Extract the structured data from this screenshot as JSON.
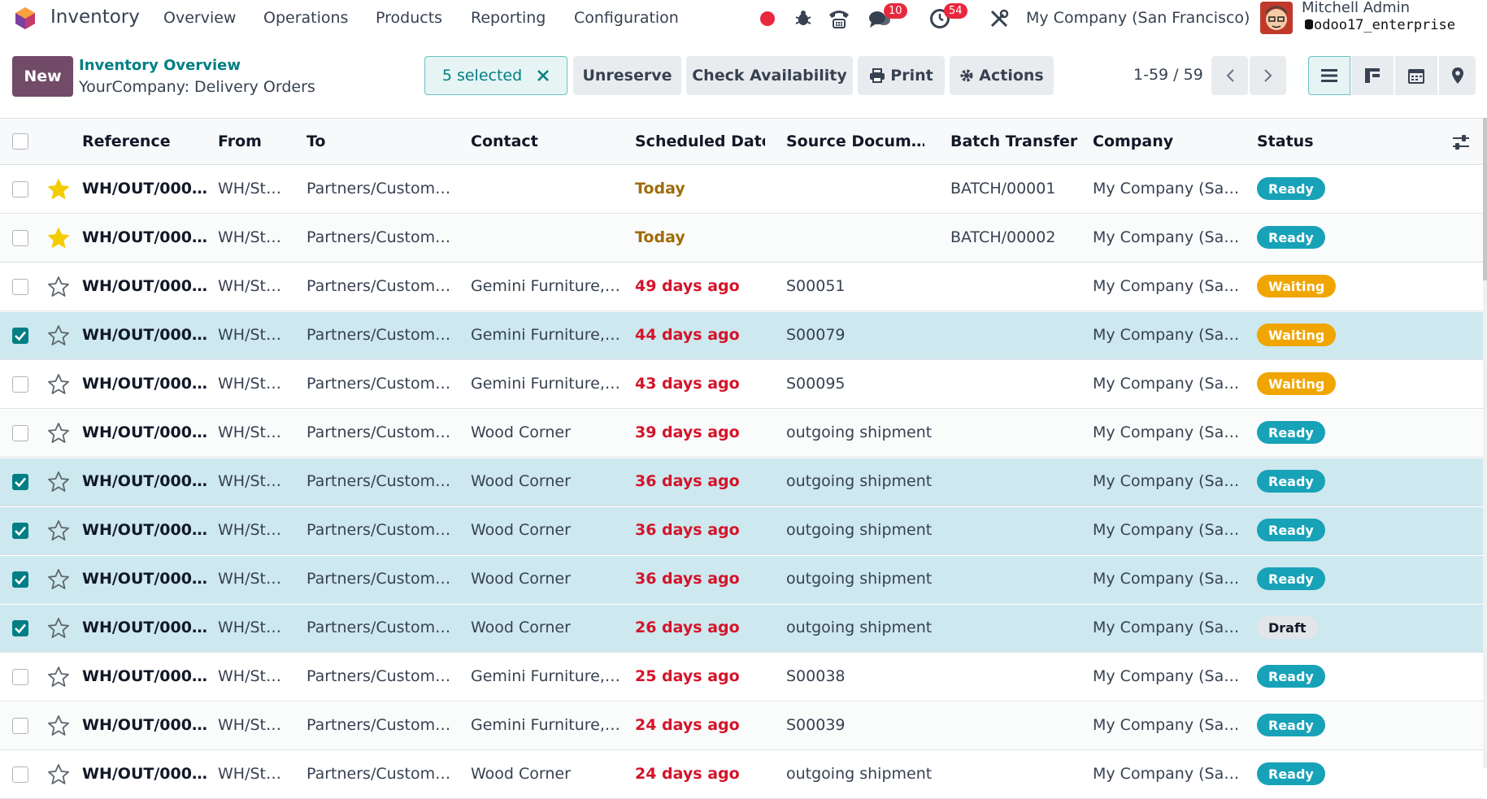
{
  "nav": {
    "app_name": "Inventory",
    "menus": [
      "Overview",
      "Operations",
      "Products",
      "Reporting",
      "Configuration"
    ],
    "messages_badge": "10",
    "activities_badge": "54",
    "company": "My Company (San Francisco)",
    "user_name": "Mitchell Admin",
    "database": "odoo17_enterprise"
  },
  "control": {
    "new_label": "New",
    "breadcrumb_parent": "Inventory Overview",
    "breadcrumb_current": "YourCompany: Delivery Orders",
    "selected_label": "5 selected",
    "unreserve_label": "Unreserve",
    "check_availability_label": "Check Availability",
    "print_label": "Print",
    "actions_label": "Actions",
    "pager": "1-59 / 59"
  },
  "table": {
    "columns": [
      "Reference",
      "From",
      "To",
      "Contact",
      "Scheduled Date",
      "Source Docum…",
      "Batch Transfer",
      "Company",
      "Status"
    ],
    "rows": [
      {
        "selected": false,
        "starred": true,
        "ref": "WH/OUT/000…",
        "from": "WH/St…",
        "to": "Partners/Custom…",
        "contact": "",
        "date": "Today",
        "date_kind": "today",
        "source": "",
        "batch": "BATCH/00001",
        "company": "My Company (Sa…",
        "status": "Ready"
      },
      {
        "selected": false,
        "starred": true,
        "ref": "WH/OUT/000…",
        "from": "WH/St…",
        "to": "Partners/Custom…",
        "contact": "",
        "date": "Today",
        "date_kind": "today",
        "source": "",
        "batch": "BATCH/00002",
        "company": "My Company (Sa…",
        "status": "Ready"
      },
      {
        "selected": false,
        "starred": false,
        "ref": "WH/OUT/000…",
        "from": "WH/St…",
        "to": "Partners/Custom…",
        "contact": "Gemini Furniture,…",
        "date": "49 days ago",
        "date_kind": "late",
        "source": "S00051",
        "batch": "",
        "company": "My Company (Sa…",
        "status": "Waiting"
      },
      {
        "selected": true,
        "starred": false,
        "ref": "WH/OUT/000…",
        "from": "WH/St…",
        "to": "Partners/Custom…",
        "contact": "Gemini Furniture,…",
        "date": "44 days ago",
        "date_kind": "late",
        "source": "S00079",
        "batch": "",
        "company": "My Company (Sa…",
        "status": "Waiting"
      },
      {
        "selected": false,
        "starred": false,
        "ref": "WH/OUT/000…",
        "from": "WH/St…",
        "to": "Partners/Custom…",
        "contact": "Gemini Furniture,…",
        "date": "43 days ago",
        "date_kind": "late",
        "source": "S00095",
        "batch": "",
        "company": "My Company (Sa…",
        "status": "Waiting"
      },
      {
        "selected": false,
        "starred": false,
        "ref": "WH/OUT/000…",
        "from": "WH/St…",
        "to": "Partners/Custom…",
        "contact": "Wood Corner",
        "date": "39 days ago",
        "date_kind": "late",
        "source": "outgoing shipment",
        "batch": "",
        "company": "My Company (Sa…",
        "status": "Ready"
      },
      {
        "selected": true,
        "starred": false,
        "ref": "WH/OUT/000…",
        "from": "WH/St…",
        "to": "Partners/Custom…",
        "contact": "Wood Corner",
        "date": "36 days ago",
        "date_kind": "late",
        "source": "outgoing shipment",
        "batch": "",
        "company": "My Company (Sa…",
        "status": "Ready"
      },
      {
        "selected": true,
        "starred": false,
        "ref": "WH/OUT/000…",
        "from": "WH/St…",
        "to": "Partners/Custom…",
        "contact": "Wood Corner",
        "date": "36 days ago",
        "date_kind": "late",
        "source": "outgoing shipment",
        "batch": "",
        "company": "My Company (Sa…",
        "status": "Ready"
      },
      {
        "selected": true,
        "starred": false,
        "ref": "WH/OUT/000…",
        "from": "WH/St…",
        "to": "Partners/Custom…",
        "contact": "Wood Corner",
        "date": "36 days ago",
        "date_kind": "late",
        "source": "outgoing shipment",
        "batch": "",
        "company": "My Company (Sa…",
        "status": "Ready"
      },
      {
        "selected": true,
        "starred": false,
        "ref": "WH/OUT/000…",
        "from": "WH/St…",
        "to": "Partners/Custom…",
        "contact": "Wood Corner",
        "date": "26 days ago",
        "date_kind": "late",
        "source": "outgoing shipment",
        "batch": "",
        "company": "My Company (Sa…",
        "status": "Draft"
      },
      {
        "selected": false,
        "starred": false,
        "ref": "WH/OUT/000…",
        "from": "WH/St…",
        "to": "Partners/Custom…",
        "contact": "Gemini Furniture,…",
        "date": "25 days ago",
        "date_kind": "late",
        "source": "S00038",
        "batch": "",
        "company": "My Company (Sa…",
        "status": "Ready"
      },
      {
        "selected": false,
        "starred": false,
        "ref": "WH/OUT/000…",
        "from": "WH/St…",
        "to": "Partners/Custom…",
        "contact": "Gemini Furniture,…",
        "date": "24 days ago",
        "date_kind": "late",
        "source": "S00039",
        "batch": "",
        "company": "My Company (Sa…",
        "status": "Ready"
      },
      {
        "selected": false,
        "starred": false,
        "ref": "WH/OUT/000…",
        "from": "WH/St…",
        "to": "Partners/Custom…",
        "contact": "Wood Corner",
        "date": "24 days ago",
        "date_kind": "late",
        "source": "outgoing shipment",
        "batch": "",
        "company": "My Company (Sa…",
        "status": "Ready"
      }
    ]
  },
  "colors": {
    "brand": "#714b67",
    "accent": "#017e84",
    "status_ready": "#17a2b8",
    "status_waiting": "#f0a500",
    "status_draft": "#e3e6e9",
    "selected_row": "#cde8ee",
    "late_date": "#d4142a",
    "today_date": "#a06b0a"
  }
}
